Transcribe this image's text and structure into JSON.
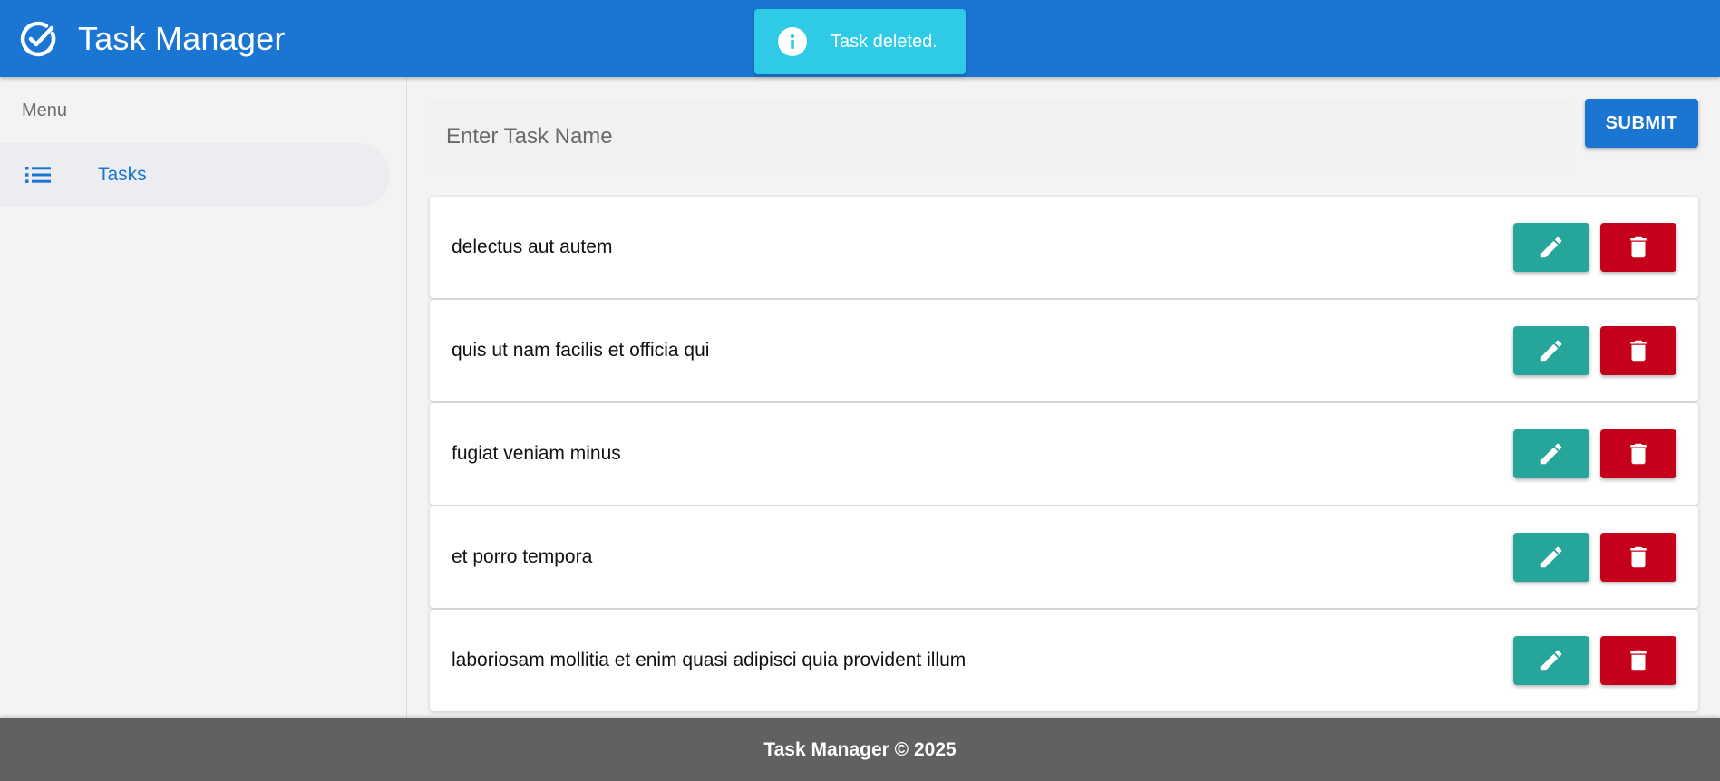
{
  "app_bar": {
    "title": "Task Manager",
    "logo_icon": "check-circle-icon",
    "color": "#1b76d3"
  },
  "snackbar": {
    "message": "Task deleted.",
    "icon": "info-icon",
    "color": "#2fcbe6"
  },
  "sidebar": {
    "header": "Menu",
    "items": [
      {
        "label": "Tasks",
        "icon": "list-icon",
        "active": true
      }
    ]
  },
  "task_form": {
    "placeholder": "Enter Task Name",
    "value": "",
    "submit_label": "SUBMIT"
  },
  "tasks": [
    {
      "name": "delectus aut autem"
    },
    {
      "name": "quis ut nam facilis et officia qui"
    },
    {
      "name": "fugiat veniam minus"
    },
    {
      "name": "et porro tempora"
    },
    {
      "name": "laboriosam mollitia et enim quasi adipisci quia provident illum"
    }
  ],
  "task_actions": {
    "edit_icon": "pencil-icon",
    "delete_icon": "trash-icon",
    "edit_color": "#26a69a",
    "delete_color": "#c4001a"
  },
  "footer": {
    "text": "Task Manager © 2025"
  }
}
